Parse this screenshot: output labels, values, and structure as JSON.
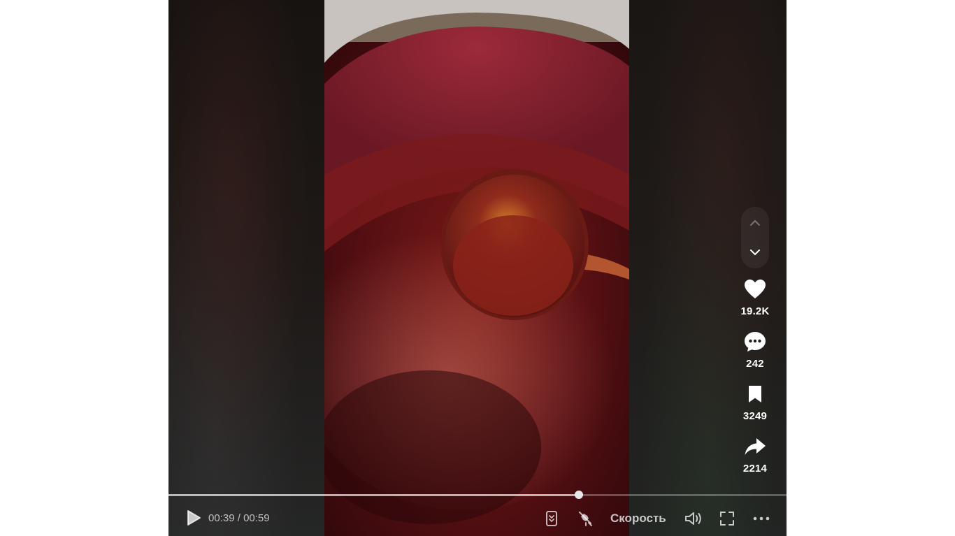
{
  "player": {
    "counts": {
      "likes": "19.2K",
      "comments": "242",
      "saves": "3249",
      "shares": "2214"
    },
    "time": {
      "current": "00:39",
      "separator": "/",
      "total": "00:59"
    },
    "speed_label": "Скорость",
    "progress_fraction": 0.664,
    "icons": {
      "nav_up": "chevron-up-icon",
      "nav_down": "chevron-down-icon",
      "like": "heart-icon",
      "comment": "comment-icon",
      "save": "bookmark-icon",
      "share": "share-icon",
      "play": "play-icon",
      "autoscroll": "autoscroll-icon",
      "pip": "floating-player-icon",
      "volume": "volume-icon",
      "fullscreen": "fullscreen-icon",
      "more": "more-icon"
    },
    "colors": {
      "background": "#ffffff",
      "player_bg": "#1f1b19",
      "icon": "#ffffff"
    }
  }
}
